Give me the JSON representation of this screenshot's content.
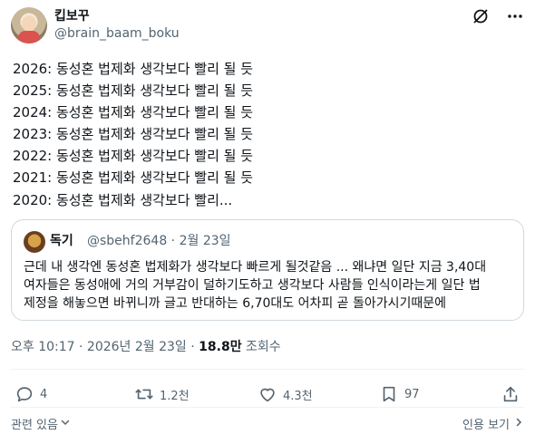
{
  "author": {
    "display_name": "킵보꾸",
    "handle": "@brain_baam_boku"
  },
  "icons": {
    "grok": "grok-icon",
    "more": "more-icon",
    "reply": "reply-icon",
    "retweet": "retweet-icon",
    "like": "like-icon",
    "bookmark": "bookmark-icon",
    "share": "share-icon"
  },
  "tweet": {
    "lines": [
      "2026: 동성혼 법제화 생각보다 빨리 될 듯",
      "2025: 동성혼 법제화 생각보다 빨리 될 듯",
      "2024: 동성혼 법제화 생각보다 빨리 될 듯",
      "2023: 동성혼 법제화 생각보다 빨리 될 듯",
      "2022: 동성혼 법제화 생각보다 빨리 될 듯",
      "2021: 동성혼 법제화 생각보다 빨리 될 듯",
      "2020: 동성혼 법제화 생각보다 빨리..."
    ]
  },
  "quote": {
    "display_name": "독기",
    "meta": "@sbehf2648 · 2월 23일",
    "lines": [
      "근데 내 생각엔 동성혼 법제화가 생각보다 빠르게 될것같음 ... 왜냐면 일단 지금 3,40대",
      "여자들은 동성애에 거의 거부감이 덜하기도하고 생각보다 사람들 인식이라는게 일단 법",
      "제정을 해놓으면 바뀌니까 글고 반대하는 6,70대도 어차피 곧 돌아가시기때문에"
    ]
  },
  "timestamp": {
    "time": "오후 10:17 · 2026년 2월 23일 · ",
    "views": "18.8만",
    "views_label": " 조회수"
  },
  "actions": {
    "replies": "4",
    "retweets": "1.2천",
    "likes": "4.3천",
    "bookmarks": "97"
  },
  "footer": {
    "related": "관련 있음",
    "quotes": "인용 보기"
  },
  "colors": {
    "text": "#0f1419",
    "secondary": "#536471",
    "border": "#cfd9de",
    "divider": "#eff3f4"
  }
}
